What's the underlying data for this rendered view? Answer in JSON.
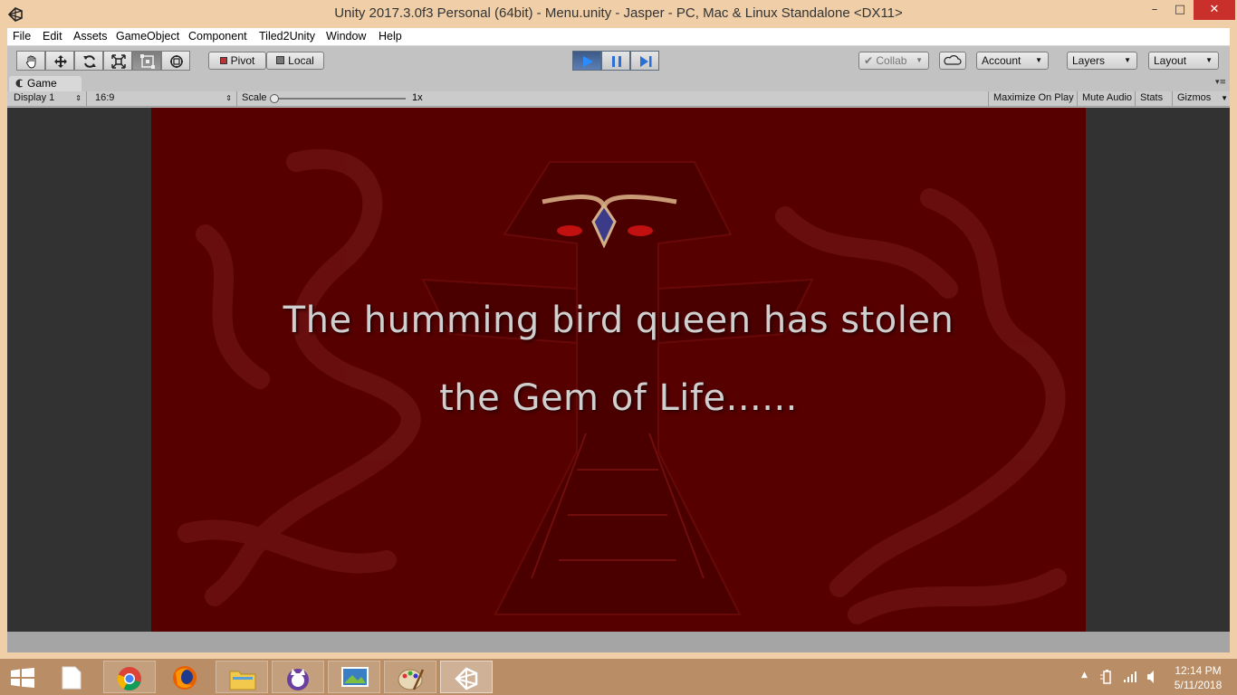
{
  "window": {
    "title": "Unity 2017.3.0f3 Personal (64bit) - Menu.unity - Jasper - PC, Mac & Linux Standalone <DX11>",
    "controls": {
      "minimize": "–",
      "maximize": "□",
      "close": "✕"
    }
  },
  "menu": {
    "items": [
      "File",
      "Edit",
      "Assets",
      "GameObject",
      "Component",
      "Tiled2Unity",
      "Window",
      "Help"
    ]
  },
  "toolbar": {
    "tools": [
      "hand-tool",
      "move-tool",
      "rotate-tool",
      "scale-tool",
      "rect-tool",
      "transform-tool"
    ],
    "active_tool": "rect-tool",
    "pivot_label": "Pivot",
    "local_label": "Local",
    "play_state": "playing",
    "collab_label": "Collab",
    "account_label": "Account",
    "layers_label": "Layers",
    "layout_label": "Layout"
  },
  "game_tab": {
    "label": "Game",
    "display": "Display 1",
    "aspect": "16:9",
    "scale_label": "Scale",
    "scale_value": "1x",
    "scale_fraction": 0.0,
    "maximize_on_play": "Maximize On Play",
    "mute_audio": "Mute Audio",
    "stats": "Stats",
    "gizmos": "Gizmos"
  },
  "scene": {
    "line1": "The humming bird queen has stolen",
    "line2": "the Gem of Life......",
    "background_color": "#560000",
    "text_color": "#cfcfcf"
  },
  "taskbar": {
    "apps": [
      "chrome-icon",
      "firefox-icon",
      "file-explorer-icon",
      "cat-app-icon",
      "photos-icon",
      "paint-icon",
      "unity-icon"
    ],
    "active_app": "unity-icon",
    "time": "12:14 PM",
    "date": "5/11/2018"
  },
  "colors": {
    "window_frame": "#f0cfa8",
    "close_button": "#c9302c",
    "taskbar": "#b98d66",
    "play_active": "#3d5a86"
  }
}
